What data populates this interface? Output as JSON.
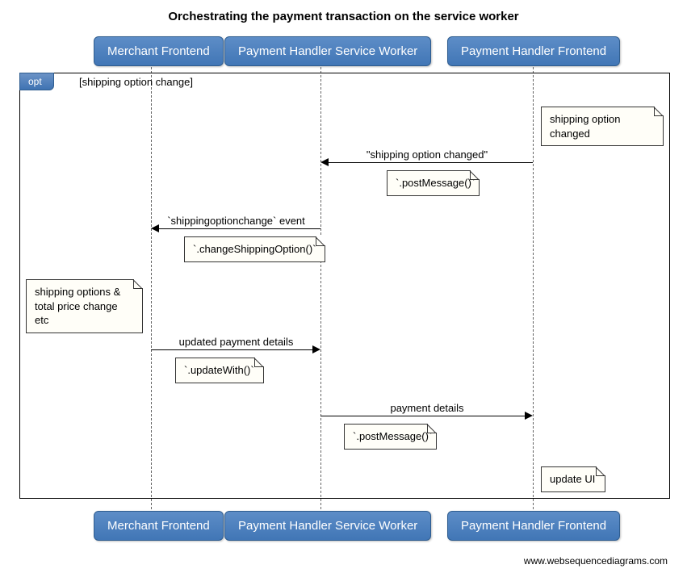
{
  "title": "Orchestrating the payment transaction on the service worker",
  "participants": {
    "p1": "Merchant Frontend",
    "p2": "Payment Handler Service Worker",
    "p3": "Payment Handler Frontend"
  },
  "opt": {
    "label": "opt",
    "guard": "[shipping option change]"
  },
  "notes": {
    "n1": "shipping option changed",
    "n2": "`.postMessage()`",
    "n3": "`.changeShippingOption()`",
    "n4": "shipping options & total price change etc",
    "n5": "`.updateWith()`",
    "n6": "`.postMessage()`",
    "n7": "update UI"
  },
  "messages": {
    "m1": "\"shipping option changed\"",
    "m2": "`shippingoptionchange` event",
    "m3": "updated payment details",
    "m4": "payment details"
  },
  "watermark": "www.websequencediagrams.com",
  "chart_data": {
    "type": "table",
    "description": "UML sequence diagram — opt fragment for shipping option change",
    "participants": [
      "Merchant Frontend",
      "Payment Handler Service Worker",
      "Payment Handler Frontend"
    ],
    "fragment": {
      "type": "opt",
      "guard": "shipping option change"
    },
    "steps": [
      {
        "type": "note",
        "over": "Payment Handler Frontend",
        "text": "shipping option changed"
      },
      {
        "type": "message",
        "from": "Payment Handler Frontend",
        "to": "Payment Handler Service Worker",
        "label": "\"shipping option changed\"",
        "note_under": "`.postMessage()`"
      },
      {
        "type": "message",
        "from": "Payment Handler Service Worker",
        "to": "Merchant Frontend",
        "label": "`shippingoptionchange` event",
        "note_under": "`.changeShippingOption()`"
      },
      {
        "type": "note",
        "over": "Merchant Frontend",
        "text": "shipping options & total price change etc"
      },
      {
        "type": "message",
        "from": "Merchant Frontend",
        "to": "Payment Handler Service Worker",
        "label": "updated payment details",
        "note_under": "`.updateWith()`"
      },
      {
        "type": "message",
        "from": "Payment Handler Service Worker",
        "to": "Payment Handler Frontend",
        "label": "payment details",
        "note_under": "`.postMessage()`"
      },
      {
        "type": "note",
        "over": "Payment Handler Frontend",
        "text": "update UI"
      }
    ]
  }
}
